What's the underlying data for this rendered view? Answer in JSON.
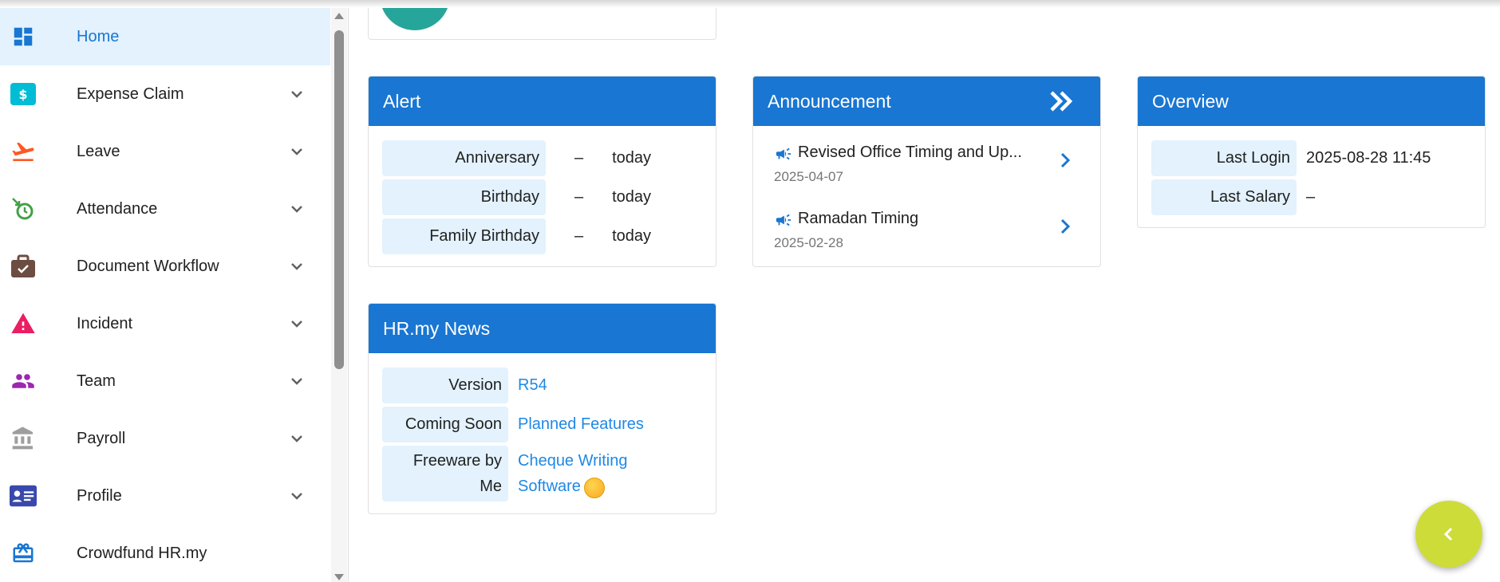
{
  "sidebar": {
    "items": [
      {
        "label": "Home",
        "icon": "dashboard-icon",
        "active": true,
        "expandable": false
      },
      {
        "label": "Expense Claim",
        "icon": "dollar-bill-icon",
        "expandable": true
      },
      {
        "label": "Leave",
        "icon": "airplane-takeoff-icon",
        "expandable": true
      },
      {
        "label": "Attendance",
        "icon": "clock-arrow-icon",
        "expandable": true
      },
      {
        "label": "Document Workflow",
        "icon": "briefcase-check-icon",
        "expandable": true
      },
      {
        "label": "Incident",
        "icon": "warning-icon",
        "expandable": true
      },
      {
        "label": "Team",
        "icon": "people-icon",
        "expandable": true
      },
      {
        "label": "Payroll",
        "icon": "bank-icon",
        "expandable": true
      },
      {
        "label": "Profile",
        "icon": "id-card-icon",
        "expandable": true
      },
      {
        "label": "Crowdfund HR.my",
        "icon": "gift-card-icon",
        "expandable": false
      }
    ]
  },
  "alert": {
    "title": "Alert",
    "rows": [
      {
        "key": "Anniversary",
        "dash": "–",
        "value": "today"
      },
      {
        "key": "Birthday",
        "dash": "–",
        "value": "today"
      },
      {
        "key": "Family Birthday",
        "dash": "–",
        "value": "today"
      }
    ]
  },
  "announcement": {
    "title": "Announcement",
    "items": [
      {
        "title": "Revised Office Timing and Up...",
        "date": "2025-04-07"
      },
      {
        "title": "Ramadan Timing",
        "date": "2025-02-28"
      }
    ]
  },
  "overview": {
    "title": "Overview",
    "rows": [
      {
        "key": "Last Login",
        "value": "2025-08-28 11:45"
      },
      {
        "key": "Last Salary",
        "value": "–"
      }
    ]
  },
  "news": {
    "title": "HR.my News",
    "rows": [
      {
        "key": "Version",
        "value": "R54"
      },
      {
        "key": "Coming Soon",
        "value": "Planned Features"
      },
      {
        "key_line1": "Freeware by",
        "key_line2": "Me",
        "value_line1": "Cheque Writing",
        "value_line2": "Software"
      }
    ]
  },
  "colors": {
    "primary": "#1976d2",
    "active_bg": "#e3f2fd",
    "link": "#1e88e5",
    "fab": "#cddc39"
  }
}
